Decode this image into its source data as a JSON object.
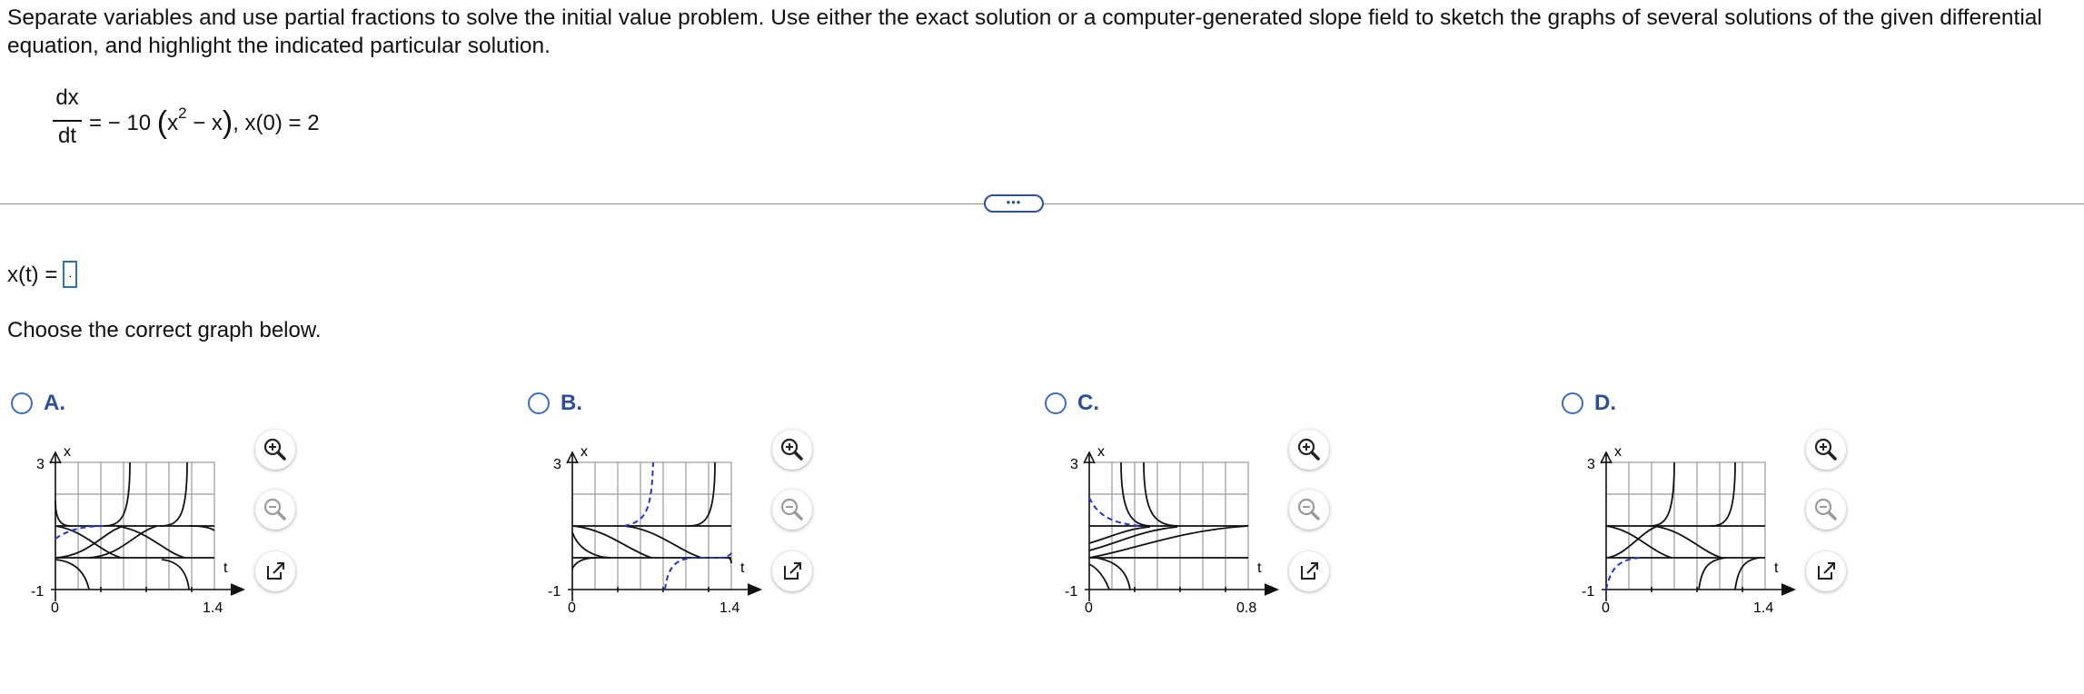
{
  "problem": {
    "text": "Separate variables and use partial fractions to solve the initial value problem. Use either the exact solution or a computer-generated slope field to sketch the graphs of several solutions of the given differential equation, and highlight the indicated particular solution."
  },
  "equation": {
    "num": "dx",
    "den": "dt",
    "rhs_prefix": "= − 10",
    "open_paren": "(",
    "x_base": "x",
    "x_exp": "2",
    "rhs_mid": " − x",
    "close_paren": ")",
    "condition": ", x(0) = 2"
  },
  "more_button": {
    "label": "•••"
  },
  "answer": {
    "label": "x(t) =",
    "value": "."
  },
  "prompt": "Choose the correct graph below.",
  "options": [
    {
      "letter": "A.",
      "y_top_label": "3",
      "y_bottom_label": "-1",
      "x_origin_label": "0",
      "x_end_label": "1.4",
      "x_axis_label": "t",
      "y_axis_label": "x"
    },
    {
      "letter": "B.",
      "y_top_label": "3",
      "y_bottom_label": "-1",
      "x_origin_label": "0",
      "x_end_label": "1.4",
      "x_axis_label": "t",
      "y_axis_label": "x"
    },
    {
      "letter": "C.",
      "y_top_label": "3",
      "y_bottom_label": "-1",
      "x_origin_label": "0",
      "x_end_label": "0.8",
      "x_axis_label": "t",
      "y_axis_label": "x"
    },
    {
      "letter": "D.",
      "y_top_label": "3",
      "y_bottom_label": "-1",
      "x_origin_label": "0",
      "x_end_label": "1.4",
      "x_axis_label": "t",
      "y_axis_label": "x"
    }
  ],
  "tools": [
    "zoom-in-icon",
    "zoom-out-icon",
    "open-new-window-icon"
  ],
  "colors": {
    "accent": "#2b4e9e",
    "highlight_curve": "#1f35d6",
    "grid": "#9a9a9a"
  }
}
